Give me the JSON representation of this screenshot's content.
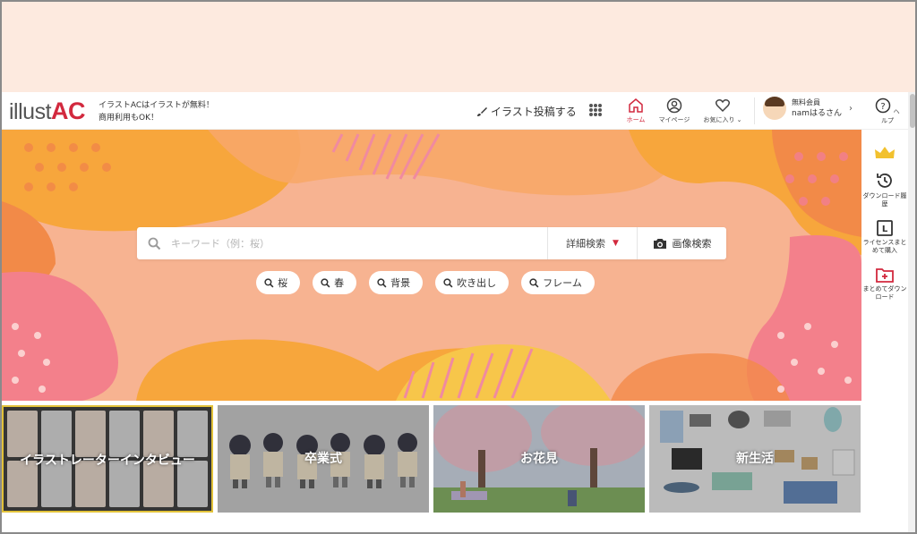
{
  "header": {
    "logo": {
      "prefix": "illust",
      "suffix": "AC"
    },
    "tagline_line1": "イラストACはイラストが無料！",
    "tagline_line2": "商用利用もOK！",
    "post_label": "イラスト投稿する",
    "nav": [
      {
        "label": "ホーム",
        "icon": "home-icon"
      },
      {
        "label": "マイページ",
        "icon": "user-circle-icon"
      },
      {
        "label": "お気に入り ⌄",
        "icon": "heart-icon"
      }
    ],
    "user": {
      "status": "無料会員",
      "name": "namはるさん"
    },
    "help_label": "ヘルプ"
  },
  "search": {
    "placeholder": "キーワード（例：桜）",
    "detail_label": "詳細検索",
    "image_search_label": "画像検索"
  },
  "tags": [
    "桜",
    "春",
    "背景",
    "吹き出し",
    "フレーム"
  ],
  "sidebar": {
    "items": [
      {
        "label": "",
        "icon": "crown-icon"
      },
      {
        "label": "ダウンロード履歴",
        "icon": "history-icon"
      },
      {
        "label": "ライセンスまとめて購入",
        "icon": "license-icon"
      },
      {
        "label": "まとめてダウンロード",
        "icon": "folder-plus-icon"
      }
    ]
  },
  "cards": [
    {
      "title": "イラストレーターインタビュー"
    },
    {
      "title": "卒業式"
    },
    {
      "title": "お花見"
    },
    {
      "title": "新生活"
    }
  ],
  "colors": {
    "accent": "#d2293e",
    "hero_bg": "#f6b290",
    "top_band": "#fdeadf"
  }
}
